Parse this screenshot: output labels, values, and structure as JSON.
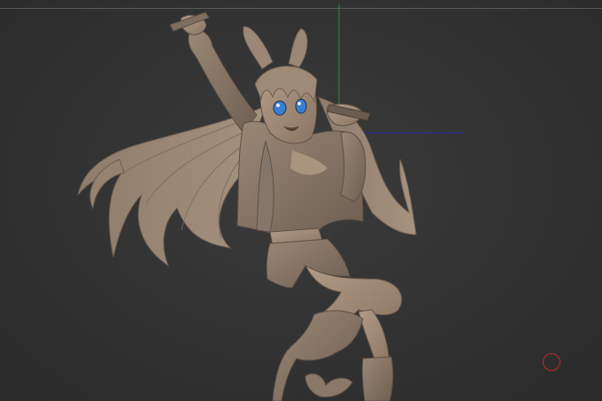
{
  "viewport": {
    "background": "#323232",
    "axis_colors": {
      "y_axis": "#2e8b2e",
      "x_axis": "#2a2ab0"
    },
    "model_color": "#9c8a78",
    "eye_color": "#3b7fd1",
    "gizmo_color": "#c0282a"
  },
  "icons": {
    "gizmo": "rotation-gizmo-icon"
  }
}
